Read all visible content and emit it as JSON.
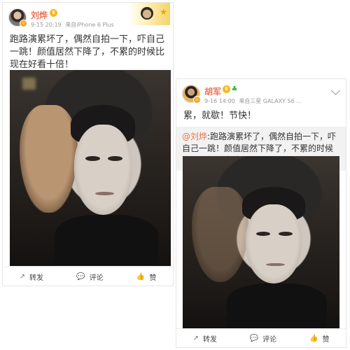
{
  "posts": [
    {
      "user": "刘烨",
      "time": "9-15 20:19",
      "source": "来自iPhone 6 Plus",
      "text": "跑路演累坏了，偶然自拍一下，吓自己一跳！颜值居然下降了，不累的时候比现在好看十倍！",
      "actions": {
        "repost": "转发",
        "comment": "评论",
        "like": "赞"
      }
    },
    {
      "user": "胡军",
      "time": "9-16 14:00",
      "source": "来自三星 GALAXY S6 ...",
      "text": "累，就歇！节快！",
      "repost": {
        "mention": "@刘烨",
        "text": ":跑路演累坏了，偶然自拍一下，吓自己一跳！颜值居然下降了，不累的时候比现在好看十倍！"
      },
      "actions": {
        "repost": "转发",
        "comment": "评论",
        "like": "赞"
      }
    }
  ],
  "icons": {
    "repost": "share-icon",
    "comment": "comment-icon",
    "like": "thumbs-up-icon",
    "more": "chevron-down-icon",
    "verified": "verified-badge-icon",
    "vip": "vip-crown-icon"
  },
  "colors": {
    "username": "#eb7350",
    "meta": "#999999",
    "like": "#f08a24"
  }
}
